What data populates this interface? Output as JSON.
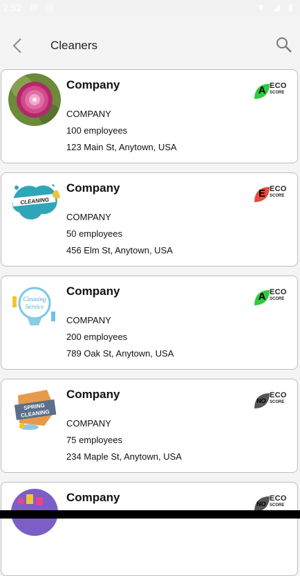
{
  "status_bar": {
    "time": "2:52"
  },
  "app_bar": {
    "title": "Cleaners"
  },
  "companies": [
    {
      "name": "Company",
      "type": "COMPANY",
      "employees": "100 employees",
      "address": "123 Main St, Anytown, USA",
      "eco_grade": "A",
      "eco_color": "#2ecc40"
    },
    {
      "name": "Company",
      "type": "COMPANY",
      "employees": "50 employees",
      "address": "456 Elm St, Anytown, USA",
      "eco_grade": "E",
      "eco_color": "#e74c3c"
    },
    {
      "name": "Company",
      "type": "COMPANY",
      "employees": "200 employees",
      "address": "789 Oak St, Anytown, USA",
      "eco_grade": "A",
      "eco_color": "#2ecc40"
    },
    {
      "name": "Company",
      "type": "COMPANY",
      "employees": "75 employees",
      "address": "234 Maple St, Anytown, USA",
      "eco_grade": "NO",
      "eco_color": "#555555"
    },
    {
      "name": "Company",
      "type": "",
      "employees": "",
      "address": "",
      "eco_grade": "NO",
      "eco_color": "#555555"
    }
  ],
  "eco_badge": {
    "eco": "ECO",
    "score": "SCORE"
  },
  "thumb_text": {
    "t2": "CLEANING",
    "t3a": "Cleaning",
    "t3b": "Service",
    "t4a": "SPRING",
    "t4b": "CLEANING"
  }
}
